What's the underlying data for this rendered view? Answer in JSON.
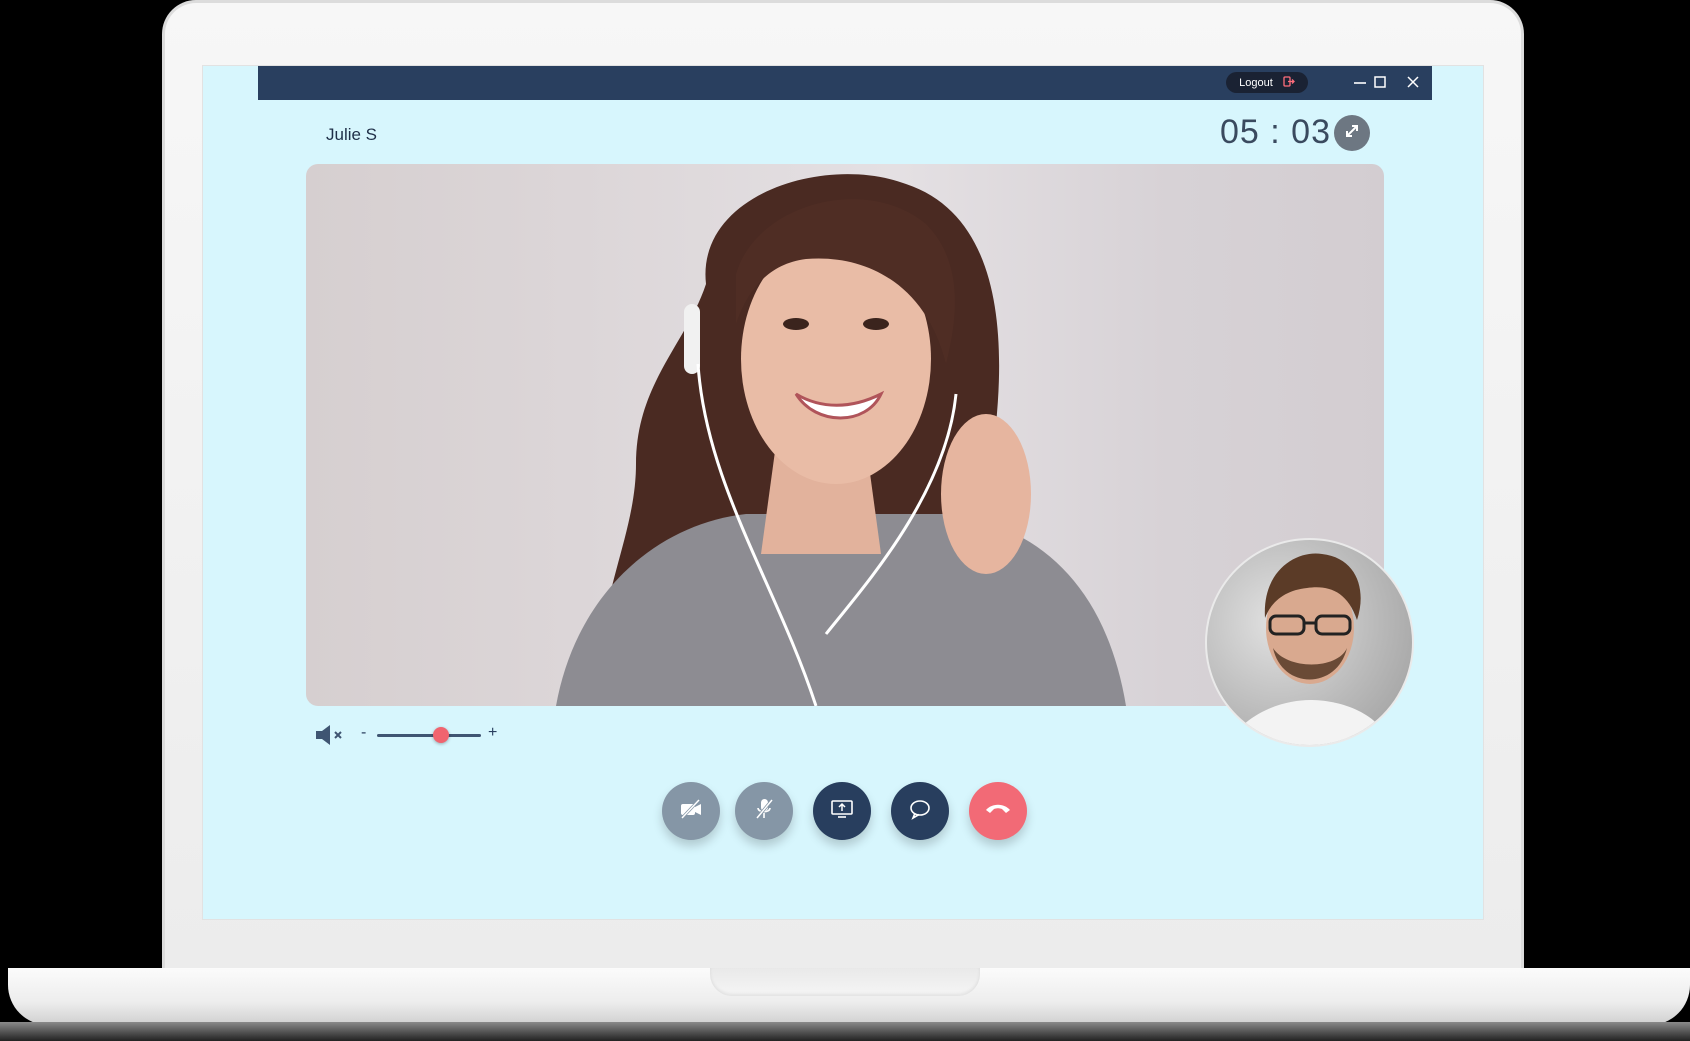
{
  "window": {
    "logout_label": "Logout",
    "logout_icon": "logout-icon",
    "controls": [
      "minimize-icon",
      "maximize-icon",
      "close-icon"
    ]
  },
  "call": {
    "caller_name": "Julie S",
    "timer": "05 : 03"
  },
  "volume": {
    "minus_label": "-",
    "plus_label": "+",
    "level": 0.62,
    "muted_icon": "speaker-muted-icon"
  },
  "controls": [
    {
      "name": "video-off-button",
      "icon": "video-off-icon"
    },
    {
      "name": "mic-off-button",
      "icon": "mic-off-icon"
    },
    {
      "name": "screen-share-button",
      "icon": "screen-share-icon"
    },
    {
      "name": "chat-button",
      "icon": "chat-icon"
    },
    {
      "name": "end-call-button",
      "icon": "hang-up-icon"
    }
  ],
  "colors": {
    "screen_bg": "#d7f6fd",
    "titlebar": "#293f5f",
    "accent_red": "#f26a76",
    "navy": "#283e5e",
    "grey": "#8596a6"
  }
}
